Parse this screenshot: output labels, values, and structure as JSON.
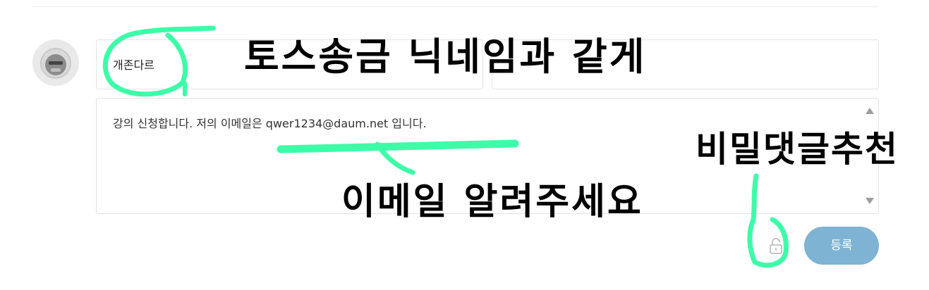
{
  "form": {
    "nickname_value": "개존다르",
    "comment_text": "강의 신청합니다. 저의 이메일은 qwer1234@daum.net 입니다.",
    "submit_label": "등록"
  },
  "annotations": {
    "nickname_note": "토스송금 닉네임과 같게",
    "secret_note": "비밀댓글추천",
    "email_note": "이메일 알려주세요"
  },
  "colors": {
    "submit_bg": "#7fb3d3",
    "highlighter": "#3dfca8"
  }
}
